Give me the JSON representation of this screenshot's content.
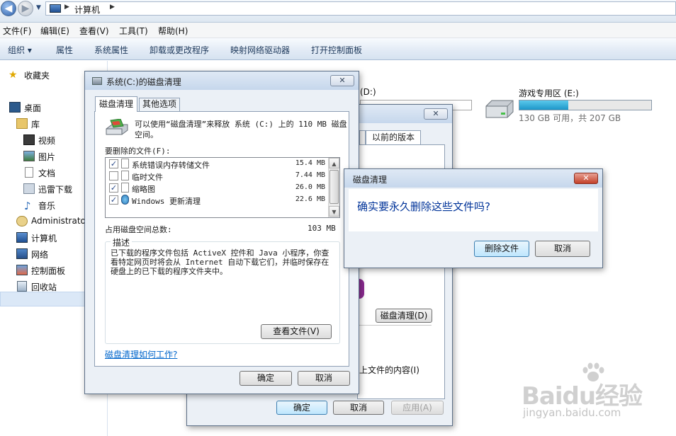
{
  "explorer": {
    "breadcrumb": "计算机",
    "menu": [
      "文件(F)",
      "编辑(E)",
      "查看(V)",
      "工具(T)",
      "帮助(H)"
    ],
    "commands": [
      "组织 ▾",
      "属性",
      "系统属性",
      "卸载或更改程序",
      "映射网络驱动器",
      "打开控制面板"
    ],
    "sidebar": [
      "收藏夹",
      "桌面",
      "库",
      "视频",
      "图片",
      "文档",
      "迅雷下载",
      "音乐",
      "Administrato",
      "计算机",
      "网络",
      "控制面板",
      "回收站"
    ],
    "drives": [
      {
        "label": "(D:)"
      },
      {
        "label": "游戏专用区 (E:)",
        "free": "130 GB 可用，共 207 GB",
        "used_fraction": 0.37
      }
    ]
  },
  "properties_window": {
    "close": "✕",
    "tab": "以前的版本",
    "cleanup_button": "磁盘清理(D)",
    "index_text": "上文件的内容(I)",
    "ok": "确定",
    "cancel": "取消",
    "apply": "应用(A)"
  },
  "cleanup_dialog": {
    "title": "系统(C:)的磁盘清理",
    "close": "✕",
    "tabs": [
      "磁盘清理",
      "其他选项"
    ],
    "intro": "可以使用“磁盘清理”来释放 系统 (C:) 上的 110 MB 磁盘空间。",
    "files_label": "要删除的文件(F):",
    "files": [
      {
        "name": "系统错误内存转储文件",
        "size": "15.4 MB",
        "checked": true
      },
      {
        "name": "临时文件",
        "size": "7.44 MB",
        "checked": false
      },
      {
        "name": "缩略图",
        "size": "26.0 MB",
        "checked": true
      },
      {
        "name": "Windows 更新清理",
        "size": "22.6 MB",
        "checked": true
      }
    ],
    "total_label": "占用磁盘空间总数:",
    "total_value": "103 MB",
    "desc_legend": "描述",
    "description": "已下载的程序文件包括 ActiveX 控件和 Java 小程序，你查看特定网页时将会从 Internet 自动下载它们，并临时保存在硬盘上的已下载的程序文件夹中。",
    "view_files": "查看文件(V)",
    "howto_link": "磁盘清理如何工作?",
    "ok": "确定",
    "cancel": "取消"
  },
  "confirm_dialog": {
    "title": "磁盘清理",
    "close": "✕",
    "question": "确实要永久删除这些文件吗?",
    "delete_button": "删除文件",
    "cancel_button": "取消"
  },
  "watermark": {
    "brand": "Baidu经验",
    "url": "jingyan.baidu.com"
  },
  "colors": {
    "accent": "#003399",
    "drive_fill": "#1d96c8",
    "close_red": "#c3412a"
  }
}
